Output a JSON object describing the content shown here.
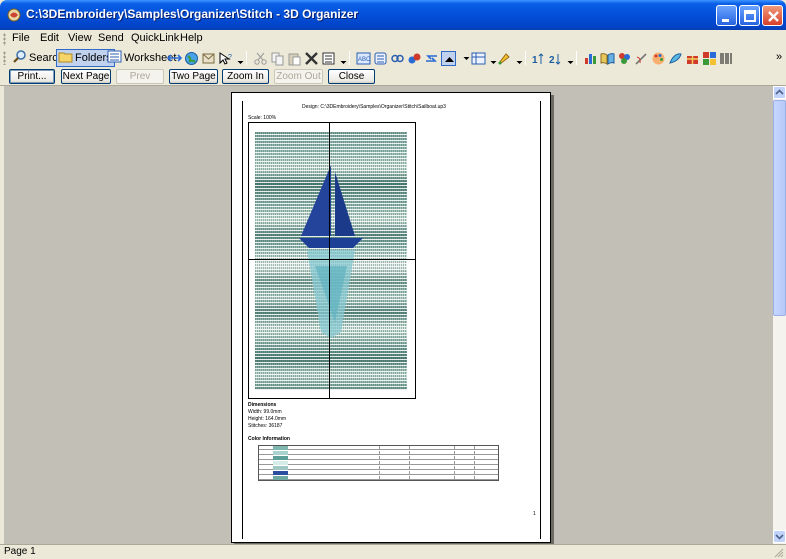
{
  "window": {
    "title": "C:\\3DEmbroidery\\Samples\\Organizer\\Stitch - 3D Organizer"
  },
  "menu": {
    "items": [
      {
        "label": "File"
      },
      {
        "label": "Edit"
      },
      {
        "label": "View"
      },
      {
        "label": "Send"
      },
      {
        "label": "QuickLink"
      },
      {
        "label": "Help"
      }
    ]
  },
  "toolbar": {
    "search_label": "Search",
    "folders_label": "Folders",
    "worksheet_label": "Worksheet",
    "overflow_glyph": "»"
  },
  "preview_buttons": {
    "print": "Print...",
    "next_page": "Next Page",
    "prev_page": "Prev Page",
    "two_page": "Two Page",
    "zoom_in": "Zoom In",
    "zoom_out": "Zoom Out",
    "close": "Close"
  },
  "page": {
    "design_path": "Design: C:\\3DEmbroidery\\Samples\\Organizer\\Stitch\\Sailboat.up3",
    "scale": "Scale: 100%",
    "dimensions_heading": "Dimensions",
    "width": "Width: 99.0mm",
    "height": "Height: 164.0mm",
    "stitches": "Stitches: 36187",
    "color_heading": "Color Information",
    "page_number": "1",
    "thread_colors": [
      "#7fb7b0",
      "#a9d3cf",
      "#5c9f98",
      "#d6ece9",
      "#9fc8c2",
      "#2c4ea0",
      "#6fa8a1"
    ]
  },
  "status": {
    "text": "Page 1"
  },
  "colors": {
    "titlebar": "#0450d8",
    "chrome": "#ece9d8",
    "preview_bg": "#c1bfb6",
    "sail": "#23449a"
  }
}
